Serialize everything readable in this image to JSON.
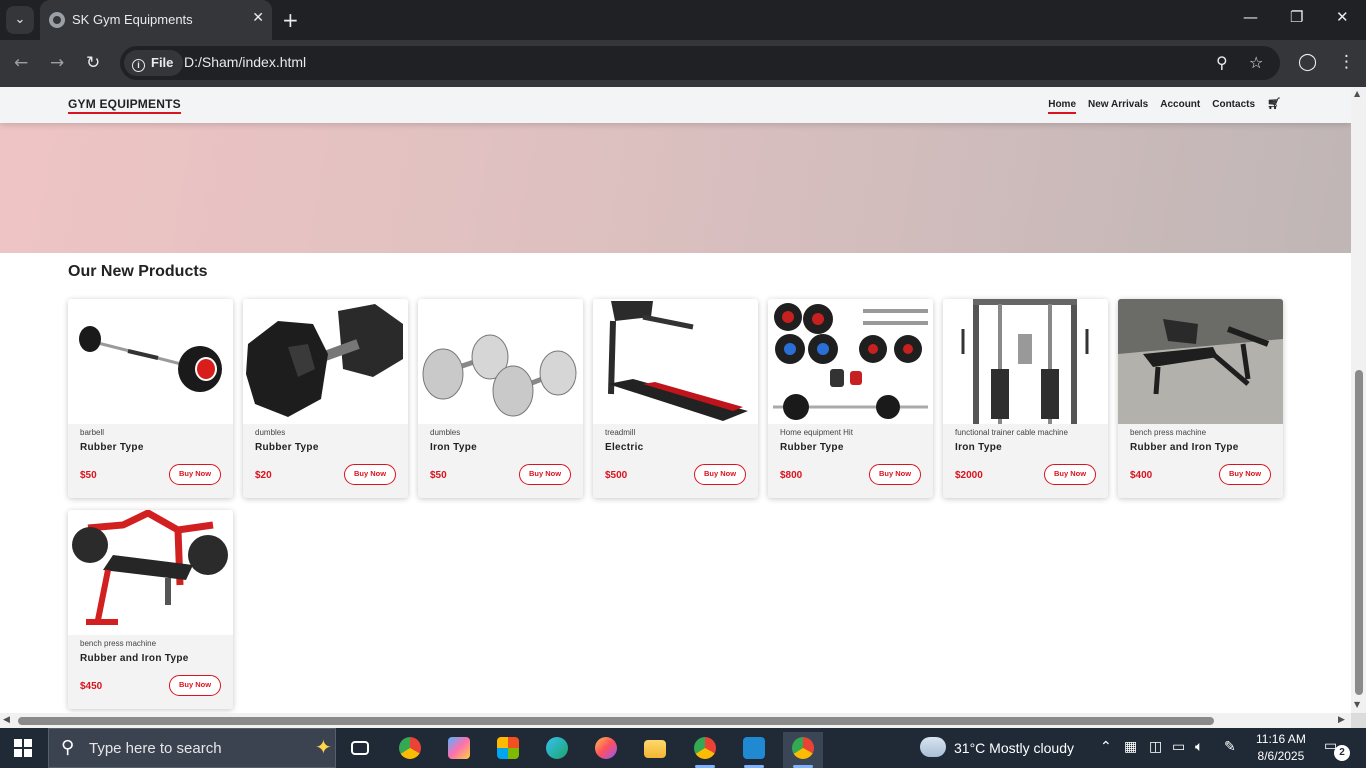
{
  "browser": {
    "tab_title": "SK Gym Equipments",
    "chip_label": "File",
    "url": "D:/Sham/index.html",
    "icons": [
      "tab-search-icon",
      "favicon-icon",
      "close-icon",
      "plus-icon",
      "back-icon",
      "forward-icon",
      "reload-icon",
      "info-icon",
      "zoom-icon",
      "star-icon",
      "profile-icon",
      "kebab-icon"
    ]
  },
  "site": {
    "logo": "GYM EQUIPMENTS",
    "nav": {
      "home": "Home",
      "new_arrivals": "New Arrivals",
      "account": "Account",
      "contacts": "Contacts"
    },
    "section_title": "Our New Products",
    "accent_color": "#d9131f",
    "buy_label": "Buy Now",
    "products": [
      {
        "category": "barbell",
        "name": "Rubber Type",
        "price": "$50",
        "image": "barbell-image"
      },
      {
        "category": "dumbles",
        "name": "Rubber Type",
        "price": "$20",
        "image": "hex-dumbbell-image"
      },
      {
        "category": "dumbles",
        "name": "Iron Type",
        "price": "$50",
        "image": "chrome-dumbbells-image"
      },
      {
        "category": "treadmill",
        "name": "Electric",
        "price": "$500",
        "image": "treadmill-image"
      },
      {
        "category": "Home equipment Hit",
        "name": "Rubber Type",
        "price": "$800",
        "image": "weight-set-image"
      },
      {
        "category": "functional trainer cable machine",
        "name": "Iron Type",
        "price": "$2000",
        "image": "cable-machine-image"
      },
      {
        "category": "bench press machine",
        "name": "Rubber and Iron Type",
        "price": "$400",
        "image": "bench-press-image"
      },
      {
        "category": "bench press machine",
        "name": "Rubber and Iron Type",
        "price": "$450",
        "image": "red-bench-press-image"
      }
    ]
  },
  "taskbar": {
    "search_placeholder": "Type here to search",
    "weather": "31°C  Mostly cloudy",
    "time": "11:16 AM",
    "date": "8/6/2025",
    "notifications": "2"
  }
}
